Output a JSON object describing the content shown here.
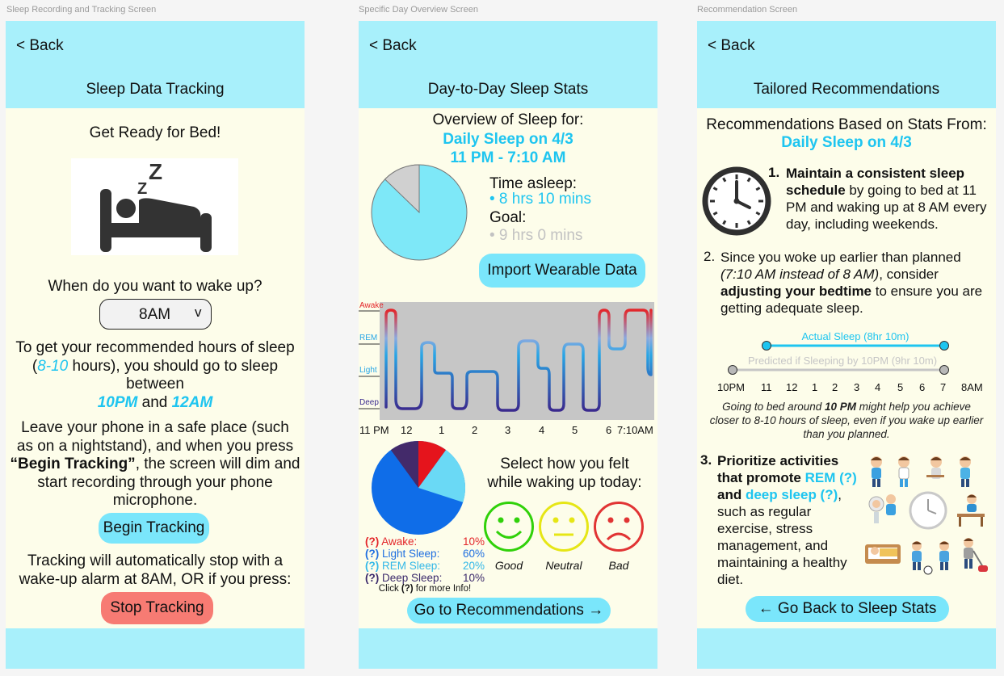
{
  "labels": {
    "screen1": "Sleep Recording and Tracking Screen",
    "screen2": "Specific Day Overview Screen",
    "screen3": "Recommendation Screen"
  },
  "screen1": {
    "back": "< Back",
    "title": "Sleep Data Tracking",
    "heading": "Get Ready for Bed!",
    "image_icon": "sleeping-in-bed-icon",
    "wake_question": "When do you want to wake up?",
    "wake_value": "8AM",
    "wake_caret": "v",
    "rec_line1": "To get your recommended hours of sleep",
    "rec_open_paren": "(",
    "rec_range": "8-10",
    "rec_line2_rest": " hours), you should go to sleep",
    "rec_between": "between",
    "time_start": "10PM",
    "and_word": " and ",
    "time_end": "12AM",
    "phone_line1": "Leave your phone in a safe place (such",
    "phone_line2": "as on a nightstand), and when you press",
    "phone_bold": "“Begin Tracking”",
    "phone_line3_rest": ", the screen will dim and",
    "phone_line4": "start recording through your phone",
    "phone_line5": "microphone.",
    "begin_button": "Begin Tracking",
    "auto_line1": "Tracking will automatically stop with a",
    "auto_line2": "wake-up alarm at 8AM, OR if you press:",
    "stop_button": "Stop Tracking"
  },
  "screen2": {
    "back": "< Back",
    "title": "Day-to-Day Sleep Stats",
    "overview": "Overview of Sleep for:",
    "date_line": "Daily Sleep on 4/3",
    "time_line": "11 PM - 7:10 AM",
    "asleep_label": "Time asleep:",
    "asleep_value": "• 8 hrs 10 mins",
    "goal_label": "Goal:",
    "goal_value": "• 9 hrs 0 mins",
    "import_button": "Import Wearable Data",
    "stage_labels": [
      "Awake",
      "REM",
      "Light",
      "Deep"
    ],
    "time_ticks": [
      "11 PM",
      "12",
      "1",
      "2",
      "3",
      "4",
      "5",
      "6",
      "7:10AM"
    ],
    "feel_line1": "Select how you felt",
    "feel_line2": "while waking up today:",
    "moods": [
      "Good",
      "Neutral",
      "Bad"
    ],
    "legend": [
      {
        "q": "(?)",
        "label": "Awake:",
        "value": "10%",
        "color": "#e3262a"
      },
      {
        "q": "(?)",
        "label": "Light Sleep:",
        "value": "60%",
        "color": "#1f6fe0"
      },
      {
        "q": "(?)",
        "label": "REM Sleep:",
        "value": "20%",
        "color": "#33b8e8"
      },
      {
        "q": "(?)",
        "label": "Deep Sleep:",
        "value": "10%",
        "color": "#3b2a6b"
      }
    ],
    "click_info_prefix": "Click ",
    "click_info_q": "(?)",
    "click_info_suffix": " for more Info!",
    "recs_button": "Go to Recommendations →"
  },
  "screen3": {
    "back": "< Back",
    "title": "Tailored Recommendations",
    "based_on": "Recommendations Based on Stats From:",
    "date_line": "Daily Sleep on 4/3",
    "r1_num": "1.",
    "r1_bold": "Maintain a consistent sleep schedule",
    "r1_rest": " by going to bed at 11 PM and waking up at 8 AM every day, including weekends.",
    "r2_num": "2.",
    "r2_a": "Since you woke up earlier than planned ",
    "r2_ital": "(7:10 AM instead of 8 AM)",
    "r2_b": ", consider ",
    "r2_bold": "adjusting your bedtime",
    "r2_c": " to ensure you are getting adequate sleep.",
    "actual_label": "Actual Sleep (8hr 10m)",
    "predicted_label": "Predicted if Sleeping by 10PM (9hr 10m)",
    "timeline_ticks": [
      "10PM",
      "11",
      "12",
      "1",
      "2",
      "3",
      "4",
      "5",
      "6",
      "7",
      "8AM"
    ],
    "going_a": "Going to bed around ",
    "going_bold": "10 PM",
    "going_b": " might help you achieve closer to 8-10 hours of sleep, even if you wake up earlier than you planned.",
    "r3_num": "3.",
    "r3_bold1": "Prioritize activities that promote ",
    "r3_rem": "REM (?)",
    "r3_and": " and ",
    "r3_deep": "deep sleep (?)",
    "r3_rest": ", such as regular exercise, stress management, and maintaining a healthy diet.",
    "back_button": "← Go Back to Sleep Stats"
  },
  "colors": {
    "bar": "#a8f0fb",
    "panel": "#fdfdea",
    "cyan": "#1ec5f0",
    "button_cyan": "#7ae6fb",
    "button_red": "#f77b73"
  }
}
